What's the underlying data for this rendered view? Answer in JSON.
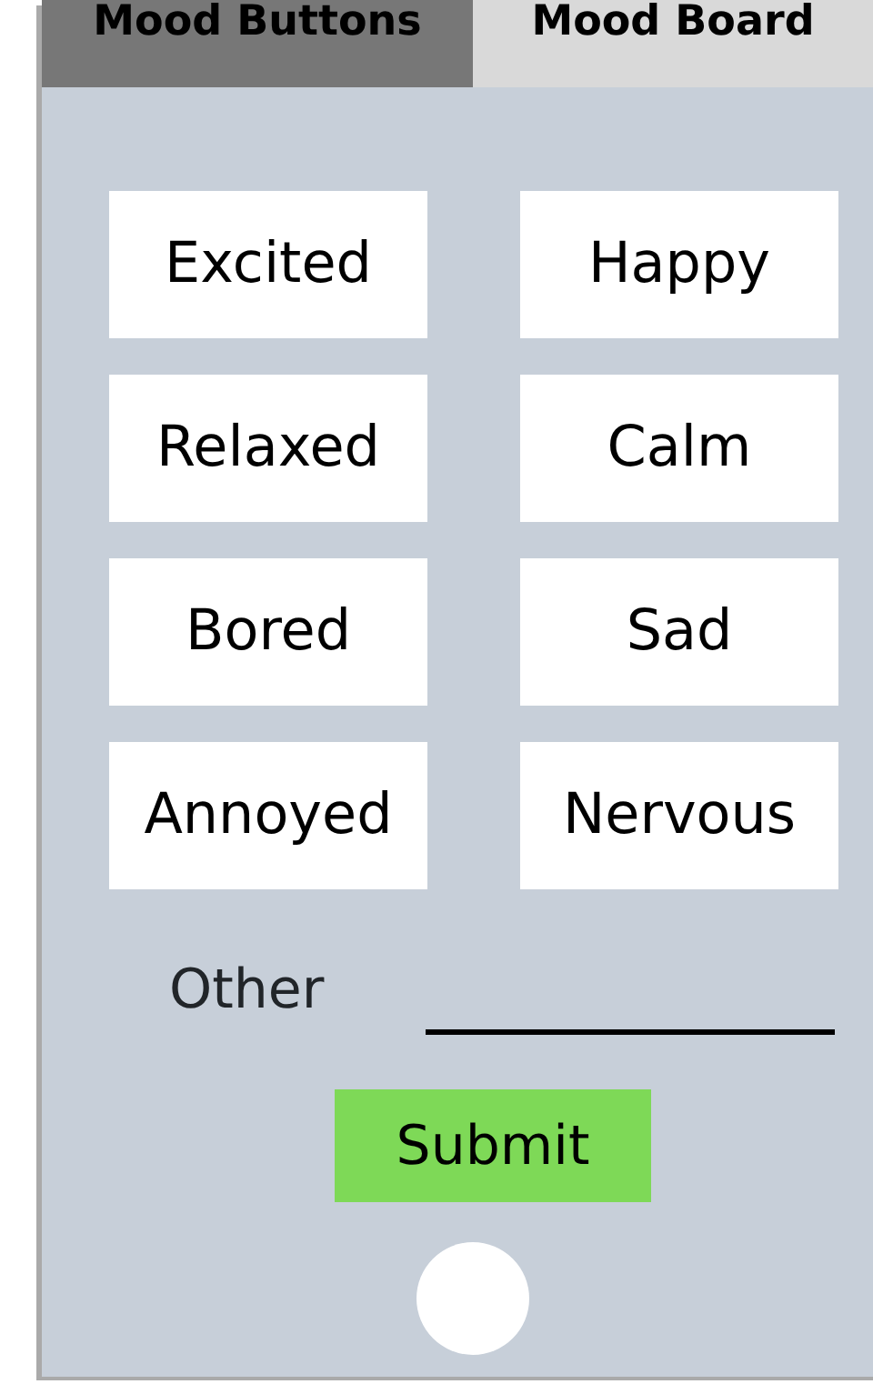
{
  "tabs": [
    {
      "label": "Mood Buttons",
      "selected": true
    },
    {
      "label": "Mood Board",
      "selected": false
    }
  ],
  "moods": [
    "Excited",
    "Happy",
    "Relaxed",
    "Calm",
    "Bored",
    "Sad",
    "Annoyed",
    "Nervous"
  ],
  "other": {
    "label": "Other"
  },
  "submit": {
    "label": "Submit"
  }
}
